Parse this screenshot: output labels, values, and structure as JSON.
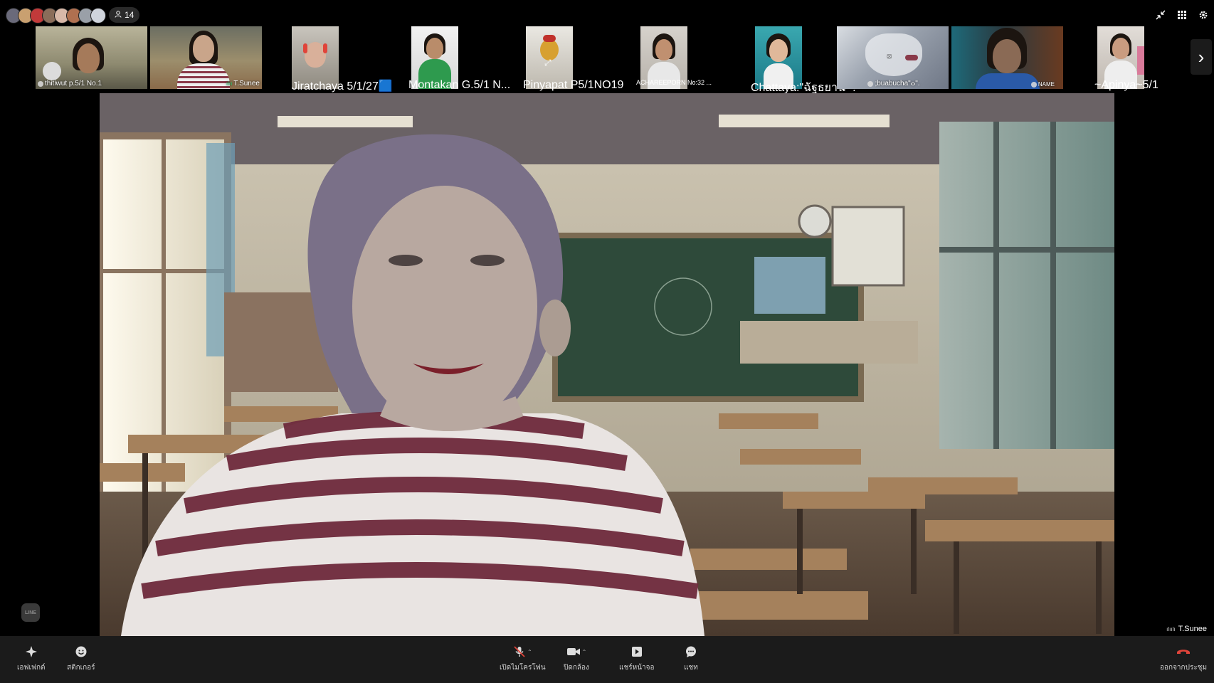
{
  "participants_count": "14",
  "participants": [
    {
      "name": "thitiwut p.5/1 No.1"
    },
    {
      "name": "T.Sunee"
    },
    {
      "name": "Jiratchaya 5/1/27🟦"
    },
    {
      "name": "Montakan G.5/1 N..."
    },
    {
      "name": "Pinyapat P5/1NO19"
    },
    {
      "name": "ACHAREEPORN No:32 ..."
    },
    {
      "name": "Chattaya:\"ฉัฐธยานี \"."
    },
    {
      "name": ";buabucha\"ⴰ\"."
    },
    {
      "name": "NAME"
    },
    {
      "name": "~Apinya~5/1"
    }
  ],
  "main_speaker": "T.Sunee",
  "line_logo": "LINE",
  "toolbar": {
    "effects": "เอฟเฟกต์",
    "stickers": "สติกเกอร์",
    "mic": "เปิดไมโครโฟน",
    "camera": "ปิดกล้อง",
    "share": "แชร์หน้าจอ",
    "chat": "แชท",
    "leave": "ออกจากประชุม"
  },
  "colors": {
    "active_outline": "#2ecc71",
    "leave_red": "#e0443a",
    "toolbar_bg": "#1b1b1b"
  }
}
